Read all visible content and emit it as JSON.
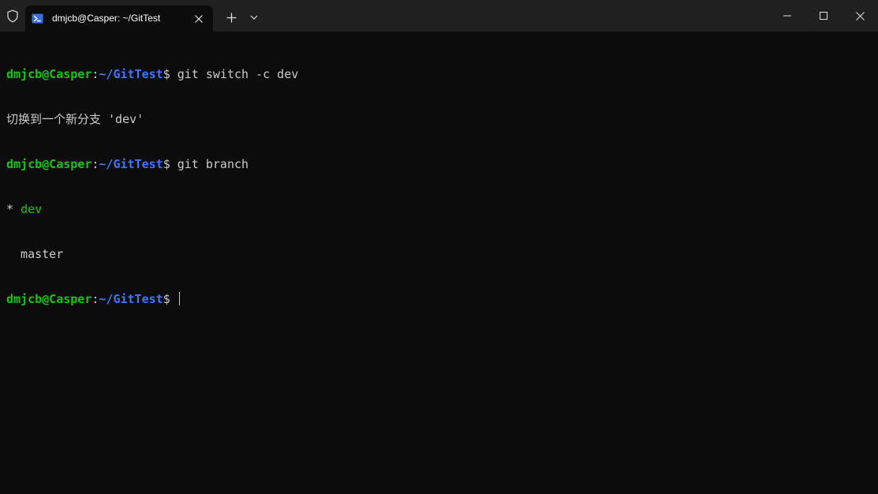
{
  "window": {
    "tab_title": "dmjcb@Casper: ~/GitTest"
  },
  "icons": {
    "shield": "shield-icon",
    "powershell": "powershell-icon",
    "tab_close": "close-icon",
    "new_tab": "plus-icon",
    "dropdown": "chevron-down-icon",
    "minimize": "minimize-icon",
    "maximize": "maximize-icon",
    "close": "close-icon"
  },
  "colors": {
    "background": "#0c0c0c",
    "titlebar": "#202020",
    "prompt_user": "#16c60c",
    "prompt_path": "#3b78ff",
    "text": "#cccccc"
  },
  "terminal": {
    "lines": [
      {
        "user": "dmjcb@Casper",
        "colon": ":",
        "path": "~/GitTest",
        "dollar": "$ ",
        "command": "git switch -c dev"
      },
      {
        "output": "切换到一个新分支 'dev'"
      },
      {
        "user": "dmjcb@Casper",
        "colon": ":",
        "path": "~/GitTest",
        "dollar": "$ ",
        "command": "git branch"
      },
      {
        "marker": "* ",
        "branch": "dev"
      },
      {
        "output": "  master"
      },
      {
        "user": "dmjcb@Casper",
        "colon": ":",
        "path": "~/GitTest",
        "dollar": "$ ",
        "command": ""
      }
    ]
  }
}
